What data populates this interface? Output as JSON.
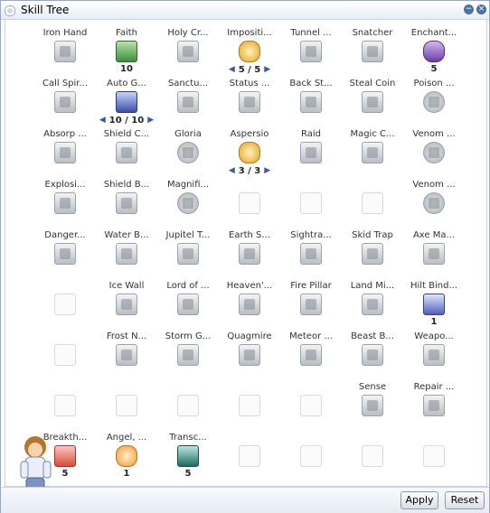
{
  "window": {
    "title": "Skill Tree"
  },
  "skills": [
    {
      "name": "Iron Hand",
      "icon": "fist-icon",
      "style": "ic-gray",
      "level": ""
    },
    {
      "name": "Faith",
      "icon": "faith-icon",
      "style": "ic-green",
      "level": "10"
    },
    {
      "name": "Holy Cr...",
      "icon": "holy-cross-icon",
      "style": "ic-gray",
      "level": ""
    },
    {
      "name": "Impositi...",
      "icon": "imposition-icon",
      "style": "ic-gold",
      "level": "5 / 5",
      "stepper": true
    },
    {
      "name": "Tunnel ...",
      "icon": "tunnel-drive-icon",
      "style": "ic-gray",
      "level": ""
    },
    {
      "name": "Snatcher",
      "icon": "snatcher-icon",
      "style": "ic-gray",
      "level": ""
    },
    {
      "name": "Enchant...",
      "icon": "enchant-icon",
      "style": "ic-purple",
      "level": "5"
    },
    {
      "name": "Call Spir...",
      "icon": "call-spirit-icon",
      "style": "ic-gray",
      "level": ""
    },
    {
      "name": "Auto G...",
      "icon": "auto-guard-icon",
      "style": "ic-blue",
      "level": "10 / 10",
      "stepper": true
    },
    {
      "name": "Sanctu...",
      "icon": "sanctuary-icon",
      "style": "ic-gray",
      "level": ""
    },
    {
      "name": "Status ...",
      "icon": "status-recovery-icon",
      "style": "ic-gray",
      "level": ""
    },
    {
      "name": "Back St...",
      "icon": "back-stab-icon",
      "style": "ic-gray",
      "level": ""
    },
    {
      "name": "Steal Coin",
      "icon": "steal-coin-icon",
      "style": "ic-gray",
      "level": ""
    },
    {
      "name": "Poison ...",
      "icon": "poison-icon",
      "style": "ic-round",
      "level": ""
    },
    {
      "name": "Absorp ...",
      "icon": "absorb-icon",
      "style": "ic-gray",
      "level": ""
    },
    {
      "name": "Shield C...",
      "icon": "shield-charge-icon",
      "style": "ic-gray",
      "level": ""
    },
    {
      "name": "Gloria",
      "icon": "gloria-icon",
      "style": "ic-round",
      "level": ""
    },
    {
      "name": "Aspersio",
      "icon": "aspersio-icon",
      "style": "ic-gold",
      "level": "3 / 3",
      "stepper": true
    },
    {
      "name": "Raid",
      "icon": "raid-icon",
      "style": "ic-gray",
      "level": ""
    },
    {
      "name": "Magic C...",
      "icon": "magic-crasher-icon",
      "style": "ic-gray",
      "level": ""
    },
    {
      "name": "Venom ...",
      "icon": "venom-icon",
      "style": "ic-round",
      "level": ""
    },
    {
      "name": "Explosi...",
      "icon": "explosion-icon",
      "style": "ic-gray",
      "level": ""
    },
    {
      "name": "Shield B...",
      "icon": "shield-boomerang-icon",
      "style": "ic-gray",
      "level": ""
    },
    {
      "name": "Magnifi...",
      "icon": "magnificat-icon",
      "style": "ic-round",
      "level": ""
    },
    {
      "name": "",
      "icon": "empty-slot-icon",
      "style": "slot",
      "level": ""
    },
    {
      "name": "",
      "icon": "empty-slot-icon",
      "style": "slot",
      "level": ""
    },
    {
      "name": "",
      "icon": "empty-slot-icon",
      "style": "slot",
      "level": ""
    },
    {
      "name": "Venom ...",
      "icon": "venom-splasher-icon",
      "style": "ic-round",
      "level": ""
    },
    {
      "name": "Danger...",
      "icon": "danger-icon",
      "style": "ic-gray",
      "level": ""
    },
    {
      "name": "Water B...",
      "icon": "water-ball-icon",
      "style": "ic-gray",
      "level": ""
    },
    {
      "name": "Jupitel T...",
      "icon": "jupitel-thunder-icon",
      "style": "ic-gray",
      "level": ""
    },
    {
      "name": "Earth S...",
      "icon": "earth-spike-icon",
      "style": "ic-gray",
      "level": ""
    },
    {
      "name": "Sightra...",
      "icon": "sightrasher-icon",
      "style": "ic-gray",
      "level": ""
    },
    {
      "name": "Skid Trap",
      "icon": "skid-trap-icon",
      "style": "ic-gray",
      "level": ""
    },
    {
      "name": "Axe Ma...",
      "icon": "axe-mastery-icon",
      "style": "ic-gray",
      "level": ""
    },
    {
      "name": "",
      "icon": "empty-slot-icon",
      "style": "slot",
      "level": ""
    },
    {
      "name": "Ice Wall",
      "icon": "ice-wall-icon",
      "style": "ic-gray",
      "level": ""
    },
    {
      "name": "Lord of ...",
      "icon": "lord-of-vermilion-icon",
      "style": "ic-gray",
      "level": ""
    },
    {
      "name": "Heaven'...",
      "icon": "heavens-drive-icon",
      "style": "ic-gray",
      "level": ""
    },
    {
      "name": "Fire Pillar",
      "icon": "fire-pillar-icon",
      "style": "ic-gray",
      "level": ""
    },
    {
      "name": "Land Mi...",
      "icon": "land-mine-icon",
      "style": "ic-gray",
      "level": ""
    },
    {
      "name": "Hilt Bind...",
      "icon": "hilt-binding-icon",
      "style": "ic-hilt",
      "level": "1"
    },
    {
      "name": "",
      "icon": "empty-slot-icon",
      "style": "slot",
      "level": ""
    },
    {
      "name": "Frost N...",
      "icon": "frost-nova-icon",
      "style": "ic-gray",
      "level": ""
    },
    {
      "name": "Storm G...",
      "icon": "storm-gust-icon",
      "style": "ic-gray",
      "level": ""
    },
    {
      "name": "Quagmire",
      "icon": "quagmire-icon",
      "style": "ic-gray",
      "level": ""
    },
    {
      "name": "Meteor ...",
      "icon": "meteor-storm-icon",
      "style": "ic-gray",
      "level": ""
    },
    {
      "name": "Beast B...",
      "icon": "beast-bane-icon",
      "style": "ic-gray",
      "level": ""
    },
    {
      "name": "Weapo...",
      "icon": "weapon-perfection-icon",
      "style": "ic-gray",
      "level": ""
    },
    {
      "name": "",
      "icon": "empty-slot-icon",
      "style": "slot",
      "level": ""
    },
    {
      "name": "",
      "icon": "empty-slot-icon",
      "style": "slot",
      "level": ""
    },
    {
      "name": "",
      "icon": "empty-slot-icon",
      "style": "slot",
      "level": ""
    },
    {
      "name": "",
      "icon": "empty-slot-icon",
      "style": "slot",
      "level": ""
    },
    {
      "name": "",
      "icon": "empty-slot-icon",
      "style": "slot",
      "level": ""
    },
    {
      "name": "Sense",
      "icon": "sense-icon",
      "style": "ic-gray",
      "level": ""
    },
    {
      "name": "Repair ...",
      "icon": "repair-weapon-icon",
      "style": "ic-gray",
      "level": ""
    },
    {
      "name": "Breakth...",
      "icon": "breakthrough-icon",
      "style": "ic-red",
      "level": "5"
    },
    {
      "name": "Angel, ...",
      "icon": "angel-icon",
      "style": "ic-orange",
      "level": "1"
    },
    {
      "name": "Transc...",
      "icon": "transcendence-icon",
      "style": "ic-teal",
      "level": "5"
    },
    {
      "name": "",
      "icon": "empty-slot-icon",
      "style": "slot",
      "level": ""
    },
    {
      "name": "",
      "icon": "empty-slot-icon",
      "style": "slot",
      "level": ""
    },
    {
      "name": "",
      "icon": "empty-slot-icon",
      "style": "slot",
      "level": ""
    },
    {
      "name": "",
      "icon": "empty-slot-icon",
      "style": "slot",
      "level": ""
    }
  ],
  "buttons": {
    "apply": "Apply",
    "reset": "Reset"
  },
  "stepper": {
    "left": "◀",
    "right": "▶"
  }
}
